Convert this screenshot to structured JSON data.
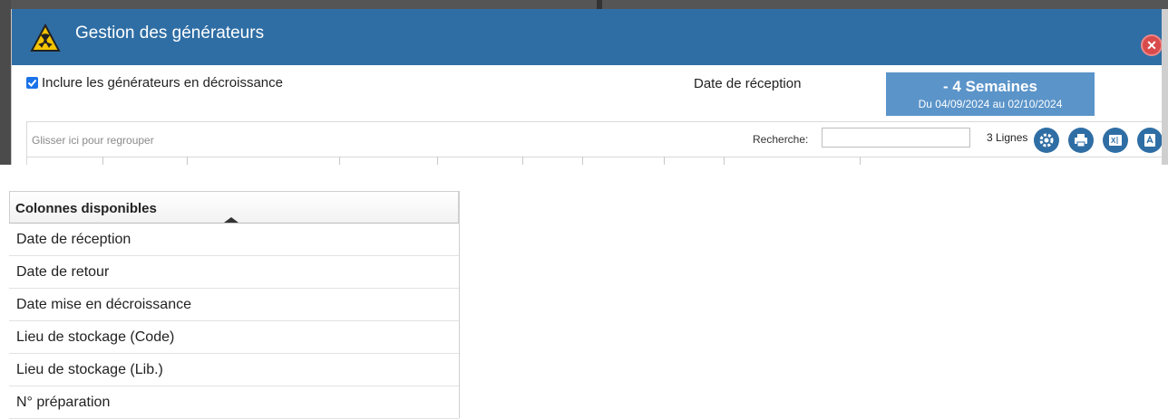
{
  "dialog": {
    "title": "Gestion des générateurs",
    "accent_color": "#2f6ea4",
    "icons": {
      "title": "radiation-warning-icon",
      "close": "close-icon"
    }
  },
  "options": {
    "include_decay_label": "Inclure les générateurs en décroissance",
    "include_decay_checked": true,
    "date_label": "Date de réception",
    "period": {
      "main": "- 4 Semaines",
      "sub": "Du 04/09/2024 au 02/10/2024"
    }
  },
  "grid": {
    "group_hint": "Glisser ici pour regrouper",
    "search_label": "Recherche:",
    "search_value": "",
    "line_count": "3 Lignes",
    "tools": [
      "settings-icon",
      "print-icon",
      "excel-export-icon",
      "pdf-export-icon"
    ]
  },
  "panel": {
    "title": "Colonnes disponibles",
    "items": [
      "Date de réception",
      "Date de retour",
      "Date mise en décroissance",
      "Lieu de stockage (Code)",
      "Lieu de stockage (Lib.)",
      "N° préparation"
    ]
  }
}
